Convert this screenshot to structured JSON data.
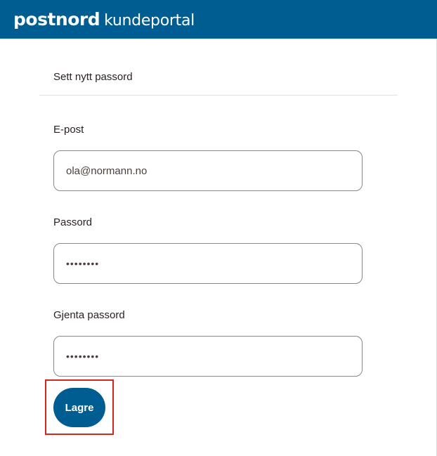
{
  "header": {
    "brand": "postnord",
    "subtitle": "kundeportal"
  },
  "form": {
    "title": "Sett nytt passord",
    "email": {
      "label": "E-post",
      "value": "ola@normann.no"
    },
    "password": {
      "label": "Passord",
      "value": "••••••••"
    },
    "repeat_password": {
      "label": "Gjenta passord",
      "value": "••••••••"
    },
    "save_label": "Lagre"
  },
  "colors": {
    "brand_blue": "#005d92",
    "highlight_red": "#d9261c"
  }
}
